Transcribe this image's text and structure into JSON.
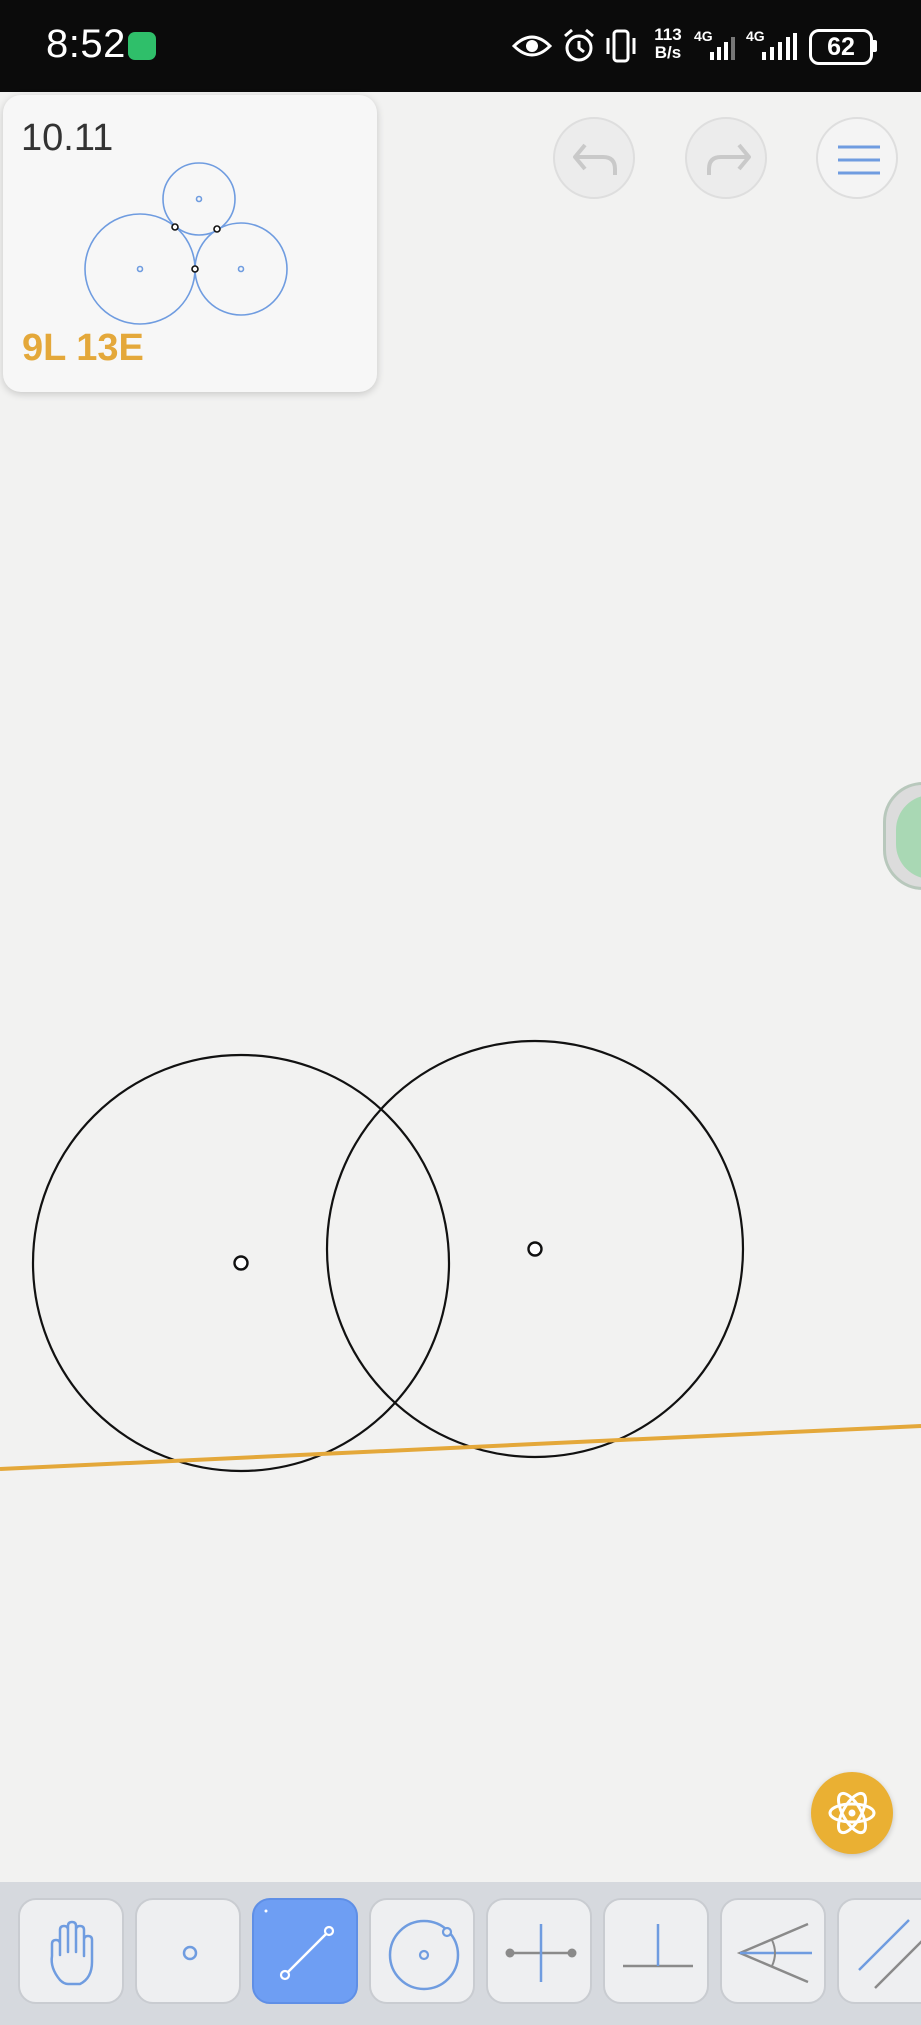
{
  "status_bar": {
    "time": "8:52",
    "speed_value": "113",
    "speed_unit": "B/s",
    "network_1": "4G",
    "network_2": "4G",
    "battery": "62",
    "icons": [
      "app-notification-icon",
      "eye-icon",
      "alarm-icon",
      "vibrate-icon",
      "signal-icon",
      "signal-icon",
      "battery-icon"
    ]
  },
  "level": {
    "number": "10.11",
    "score_lines": "9L",
    "score_euclid": "13E"
  },
  "top_buttons": {
    "undo": "undo-icon",
    "redo": "redo-icon",
    "menu": "menu-icon"
  },
  "colors": {
    "line_accent": "#e4a83a",
    "tool_active": "#6e9ef3",
    "goal_blue": "#6f9ce0",
    "fab": "#eab033"
  },
  "toolbar": {
    "tools": [
      {
        "name": "move",
        "icon": "hand-icon",
        "active": false
      },
      {
        "name": "point",
        "icon": "point-icon",
        "active": false
      },
      {
        "name": "line",
        "icon": "line-icon",
        "active": true
      },
      {
        "name": "circle",
        "icon": "circle-icon",
        "active": false
      },
      {
        "name": "perpendicular-bisector",
        "icon": "perpendicular-bisector-icon",
        "active": false
      },
      {
        "name": "perpendicular",
        "icon": "perpendicular-icon",
        "active": false
      },
      {
        "name": "angle-bisector",
        "icon": "angle-bisector-icon",
        "active": false
      },
      {
        "name": "parallel",
        "icon": "parallel-icon",
        "active": false
      }
    ]
  },
  "fab_icon": "atom-icon"
}
